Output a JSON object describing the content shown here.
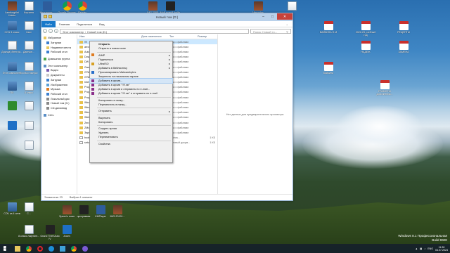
{
  "desktop": {
    "icons": [
      {
        "id": "lamborghini",
        "label": "Lamborghini Hotels",
        "kind": "img"
      },
      {
        "id": "korzina",
        "label": "Корзина",
        "kind": "doc"
      },
      {
        "id": "inst",
        "label": "Инстаграм...",
        "kind": "app"
      },
      {
        "id": "chrome1",
        "label": "Google Chrome",
        "kind": "chrome"
      },
      {
        "id": "chrome2",
        "label": "Reader",
        "kind": "chrome"
      },
      {
        "id": "img2085",
        "label": "IMG 2085",
        "kind": "img"
      },
      {
        "id": "moy",
        "label": "Мой новый файл",
        "kind": "dark"
      },
      {
        "id": "mercedes",
        "label": "Mercedes",
        "kind": "img"
      },
      {
        "id": "doc-top-right",
        "label": "",
        "kind": "doc"
      },
      {
        "id": "sochi",
        "label": "СОЧ 3 класс",
        "kind": "pc"
      },
      {
        "id": "user",
        "label": "User",
        "kind": "doc"
      },
      {
        "id": "doklad",
        "label": "Доклад Интегра...",
        "kind": "doc"
      },
      {
        "id": "dannye",
        "label": "Данные...",
        "kind": "doc"
      },
      {
        "id": "etot-kompyuter",
        "label": "Этот компьютер",
        "kind": "pc"
      },
      {
        "id": "8klass",
        "label": "8 класс выпуск",
        "kind": "doc"
      },
      {
        "id": "pc2",
        "label": "ПК",
        "kind": "pc"
      },
      {
        "id": "8klass2",
        "label": "8 класс",
        "kind": "doc"
      },
      {
        "id": "app-a",
        "label": "",
        "kind": "green"
      },
      {
        "id": "app-b",
        "label": "",
        "kind": "blue"
      },
      {
        "id": "doc-a",
        "label": "",
        "kind": "doc"
      },
      {
        "id": "doc-b",
        "label": "",
        "kind": "doc"
      },
      {
        "id": "doc-c",
        "label": "",
        "kind": "doc"
      },
      {
        "id": "sochi4",
        "label": "СОЧ за 4 четв",
        "kind": "pc"
      },
      {
        "id": "s2",
        "label": "С...",
        "kind": "doc"
      },
      {
        "id": "bayka",
        "label": "БАЙКИНА Н.М",
        "kind": "pdf"
      },
      {
        "id": "uchgod",
        "label": "2022-23 учебный год",
        "kind": "pdf"
      },
      {
        "id": "recepty",
        "label": "РЕЦЕПТЫ",
        "kind": "pdf"
      },
      {
        "id": "nadezh",
        "label": "НАДЕЖ",
        "kind": "pdf"
      },
      {
        "id": "zamena",
        "label": "ЗАМЕНА",
        "kind": "pdf"
      },
      {
        "id": "baykina2",
        "label": "Байкина",
        "kind": "pdf"
      },
      {
        "id": "gramoty",
        "label": "ГРАМОТЫ дополнения...",
        "kind": "pdf"
      },
      {
        "id": "tb1",
        "label": "8 класс лифтинг...",
        "kind": "doc"
      },
      {
        "id": "tb2",
        "label": "Grand Theft Auto IV",
        "kind": "dark"
      },
      {
        "id": "tb3",
        "label": "Zoom",
        "kind": "blue"
      },
      {
        "id": "tb4",
        "label": "Speed к новн",
        "kind": "img"
      },
      {
        "id": "tb5",
        "label": "программы",
        "kind": "dark"
      },
      {
        "id": "tb6",
        "label": "KMPlayer",
        "kind": "app"
      },
      {
        "id": "tb7",
        "label": "IMG-20191...",
        "kind": "img"
      }
    ]
  },
  "window": {
    "title": "Новый том (D:)",
    "ribbon_tabs": [
      "Файл",
      "Главная",
      "Поделиться",
      "Вид"
    ],
    "address_path": [
      "Этот компьютер",
      "Новый том (D:)"
    ],
    "search_placeholder": "Поиск: Новый то...",
    "nav_items": [
      {
        "label": "Избранное",
        "sub": false
      },
      {
        "label": "Загрузки",
        "sub": true
      },
      {
        "label": "Недавние места",
        "sub": true
      },
      {
        "label": "Рабочий стол",
        "sub": true
      },
      {
        "label": "Домашняя группа",
        "sub": false,
        "gap": true
      },
      {
        "label": "Этот компьютер",
        "sub": false,
        "gap": true
      },
      {
        "label": "Видео",
        "sub": true
      },
      {
        "label": "Документы",
        "sub": true
      },
      {
        "label": "Загрузки",
        "sub": true
      },
      {
        "label": "Изображения",
        "sub": true
      },
      {
        "label": "Музыка",
        "sub": true
      },
      {
        "label": "Рабочий стол",
        "sub": true
      },
      {
        "label": "Локальный дис",
        "sub": true
      },
      {
        "label": "Новый том (D:)",
        "sub": true
      },
      {
        "label": "CD-дисковод",
        "sub": true
      },
      {
        "label": "Сеть",
        "sub": false,
        "gap": true
      }
    ],
    "columns": [
      "Имя",
      "Дата изменения",
      "Тип",
      "Размер"
    ],
    "files": [
      {
        "name": "!!!!",
        "date": "04.07.2016 11:46",
        "type": "Папка с файлами",
        "size": ""
      },
      {
        "name": "arrose",
        "date": "",
        "type": "Папка с файлами",
        "size": ""
      },
      {
        "name": "Autoc",
        "date": "",
        "type": "Папка с файлами",
        "size": ""
      },
      {
        "name": "Down",
        "date": "",
        "type": "Папка с файлами",
        "size": ""
      },
      {
        "name": "DW",
        "date": "",
        "type": "Папка с файлами",
        "size": ""
      },
      {
        "name": "Gam",
        "date": "",
        "type": "Папка с файлами",
        "size": ""
      },
      {
        "name": "GTA",
        "date": "",
        "type": "Папка с файлами",
        "size": ""
      },
      {
        "name": "GTA",
        "date": "",
        "type": "Папка с файлами",
        "size": ""
      },
      {
        "name": "Intel",
        "date": "",
        "type": "Папка с файлами",
        "size": ""
      },
      {
        "name": "Prog",
        "date": "",
        "type": "Папка с файлами",
        "size": ""
      },
      {
        "name": "Prog",
        "date": "",
        "type": "Папка с файлами",
        "size": ""
      },
      {
        "name": "Prog",
        "date": "",
        "type": "Папка с файлами",
        "size": ""
      },
      {
        "name": "Wind",
        "date": "",
        "type": "Папка с файлами",
        "size": ""
      },
      {
        "name": "Wind",
        "date": "",
        "type": "Папка с файлами",
        "size": ""
      },
      {
        "name": "Wind",
        "date": "",
        "type": "Папка с файлами",
        "size": ""
      },
      {
        "name": "WinR",
        "date": "",
        "type": "Папка с файлами",
        "size": ""
      },
      {
        "name": "Zero",
        "date": "",
        "type": "Папка с файлами",
        "size": ""
      },
      {
        "name": "ZMo",
        "date": "",
        "type": "Папка с файлами",
        "size": ""
      },
      {
        "name": "Зару",
        "date": "",
        "type": "Папка с файлами",
        "size": ""
      },
      {
        "name": "boot",
        "date": "",
        "type": "Windows...",
        "size": "1 КБ"
      },
      {
        "name": "setup",
        "date": "",
        "type": "Текстовый докум...",
        "size": "1 КБ"
      }
    ],
    "preview_text": "Нет данных для предварительного просмотра.",
    "status_items": "Элементов: 23",
    "status_selected": "Выбран 1 элемент"
  },
  "context_menu": [
    {
      "label": "Открыть",
      "bold": true
    },
    {
      "label": "Открыть в новом окне"
    },
    {
      "sep": true
    },
    {
      "label": "AIMP",
      "arrow": true,
      "icon": "#e07b20"
    },
    {
      "label": "Поделиться",
      "arrow": true
    },
    {
      "label": "UltraISO",
      "arrow": true,
      "icon": "#d8a021"
    },
    {
      "label": "Добавить в библиотеку",
      "arrow": true
    },
    {
      "label": "Просканировать Malwarebytes",
      "icon": "#2a6fc9"
    },
    {
      "label": "Закрепить на начальном экране"
    },
    {
      "label": "Добавить в архив...",
      "icon": "#8b2f8b",
      "hl": true
    },
    {
      "label": "Добавить в архив \"!!!!.rar\"",
      "icon": "#8b2f8b"
    },
    {
      "label": "Добавить в архив и отправить по e-mail...",
      "icon": "#8b2f8b"
    },
    {
      "label": "Добавить в архив \"!!!!.rar\" и отправить по e-mail",
      "icon": "#8b2f8b"
    },
    {
      "sep": true
    },
    {
      "label": "Копировать в папку..."
    },
    {
      "label": "Переместить в папку..."
    },
    {
      "sep": true
    },
    {
      "label": "Отправить",
      "arrow": true
    },
    {
      "sep": true
    },
    {
      "label": "Вырезать"
    },
    {
      "label": "Копировать"
    },
    {
      "sep": true
    },
    {
      "label": "Создать ярлык"
    },
    {
      "label": "Удалить"
    },
    {
      "label": "Переименовать"
    },
    {
      "sep": true
    },
    {
      "label": "Свойства"
    }
  ],
  "taskbar": {
    "apps": [
      "start",
      "explorer",
      "chrome",
      "opera",
      "ie",
      "folder",
      "chrome2",
      "yandex"
    ],
    "lang": "ENG",
    "time": "11:30",
    "date": "04.07.2024"
  },
  "watermark": {
    "line1": "Windows 8.1 Профессиональная",
    "line2": "Build 9600"
  }
}
